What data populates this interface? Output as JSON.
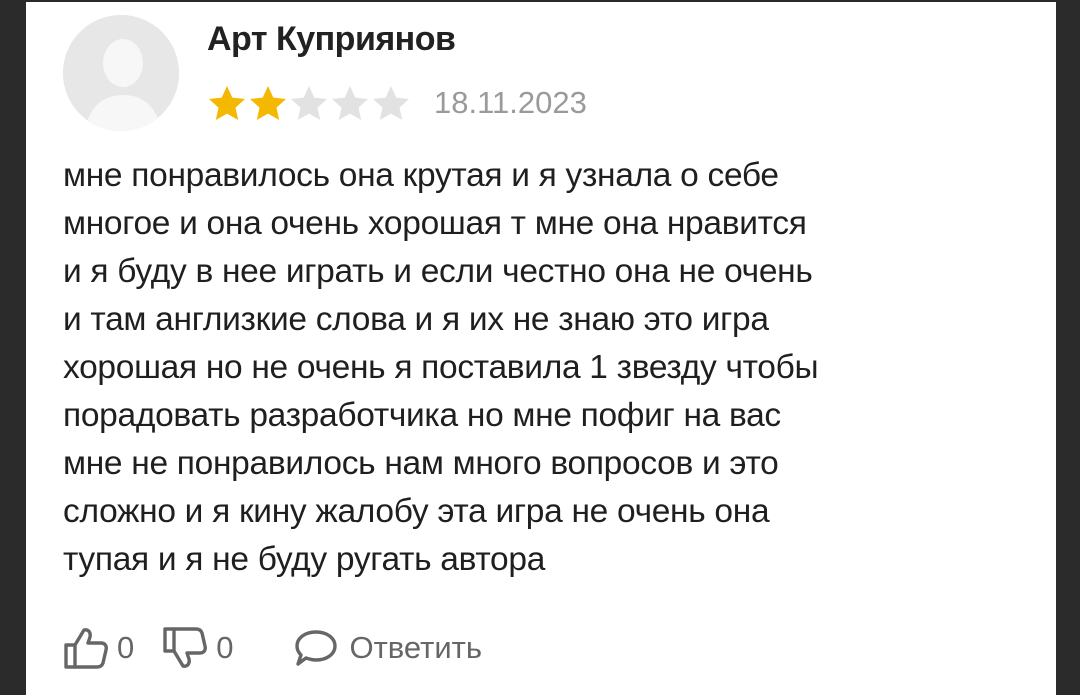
{
  "review": {
    "author": "Арт Куприянов",
    "date": "18.11.2023",
    "rating": 2,
    "max_rating": 5,
    "lines": [
      "мне понравилось она крутая и я узнала о себе",
      "многое и она очень хорошая т мне она нравится",
      "и я буду в нее играть и если честно она не очень",
      "и там англизкие слова и я их не знаю это игра",
      "хорошая но не очень я поставила 1 звезду чтобы",
      "порадовать разработчика но мне пофиг на вас",
      "мне не понравилось нам много вопросов и это",
      "сложно и я кину жалобу эта игра не очень она",
      "тупая и я не буду ругать автора"
    ]
  },
  "actions": {
    "likes": "0",
    "dislikes": "0",
    "reply_label": "Ответить"
  },
  "colors": {
    "star_filled": "#f5b800",
    "star_empty": "#e2e2e2",
    "text": "#1f1f1f",
    "muted": "#9a9a9a"
  },
  "icons": {
    "avatar": "user-silhouette",
    "like": "thumbs-up-icon",
    "dislike": "thumbs-down-icon",
    "reply": "speech-bubble-icon"
  }
}
